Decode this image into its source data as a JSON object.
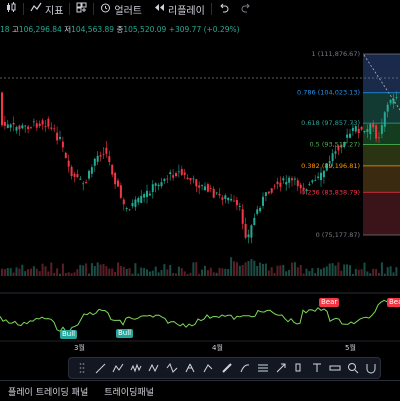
{
  "toolbar": {
    "indicators_label": "지표",
    "alert_label": "얼러트",
    "replay_label": "리플레이"
  },
  "ohlc": {
    "open_tail": "18",
    "high_label": "고",
    "high_value": "106,296.84",
    "low_label": "저",
    "low_value": "104,563.89",
    "close_label": "종",
    "close_value": "105,520.09",
    "change": "+309.77 (+0.29%)"
  },
  "fib_levels": [
    {
      "ratio": "1",
      "price": "111,876.67",
      "text": "1 (111,876.67)",
      "color": "#787b86"
    },
    {
      "ratio": "0.786",
      "price": "104,023.13",
      "text": "0.786 (104,023.13)",
      "color": "#2196f3"
    },
    {
      "ratio": "0.618",
      "price": "97,857.73",
      "text": "0.618 (97,857.73)",
      "color": "#26a69a"
    },
    {
      "ratio": "0.5",
      "price": "93,517.27",
      "text": "0.5 (93,517.27)",
      "color": "#4caf50"
    },
    {
      "ratio": "0.382",
      "price": "89,196.81",
      "text": "0.382 (89,196.81)",
      "color": "#ff9800"
    },
    {
      "ratio": "0.236",
      "price": "83,838.79",
      "text": "0.236 (83,838.79)",
      "color": "#f23645"
    },
    {
      "ratio": "0",
      "price": "75,177.87",
      "text": "0 (75,177.87)",
      "color": "#787b86"
    }
  ],
  "x_axis": {
    "months": [
      "3월",
      "4월",
      "5월"
    ]
  },
  "signals": {
    "bull_label": "Bull",
    "bear_label": "Bear"
  },
  "colors": {
    "up": "#22ab94",
    "down": "#f23645",
    "oscillator": "#7ed957",
    "background": "#000000"
  },
  "drawing_tools": [
    "trend-line-icon",
    "path-icon",
    "wave-icon",
    "zigzag-icon",
    "pattern-icon",
    "pitchfork-icon",
    "projection-icon",
    "ruler-icon",
    "brush-icon",
    "fib-icon",
    "arrow-icon",
    "highlighter-icon",
    "text-icon",
    "measure-icon",
    "zoom-icon",
    "magnet-icon"
  ],
  "bottom_tabs": [
    "플레이 트레이딩 패널",
    "트레이딩패널"
  ]
}
